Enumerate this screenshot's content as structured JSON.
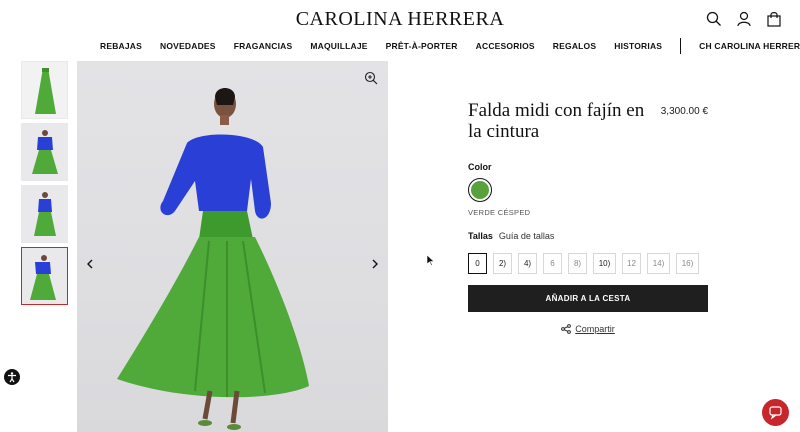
{
  "header": {
    "logo": "CAROLINA HERRERA",
    "icons": [
      "search-icon",
      "user-icon",
      "bag-icon"
    ]
  },
  "nav": {
    "items": [
      "REBAJAS",
      "NOVEDADES",
      "FRAGANCIAS",
      "MAQUILLAJE",
      "PRÊT-À-PORTER",
      "ACCESORIOS",
      "REGALOS",
      "HISTORIAS"
    ],
    "extra": "CH CAROLINA HERRERA"
  },
  "gallery": {
    "thumbnail_count": 4,
    "active_thumbnail": 4,
    "icons": [
      "zoom-icon",
      "arrow-left-icon",
      "arrow-right-icon"
    ]
  },
  "product": {
    "title": "Falda midi con fajín en la cintura",
    "price": "3,300.00 €",
    "color_label": "Color",
    "color_name": "VERDE CÉSPED",
    "swatch_color": "#5aa13d",
    "sizes_label": "Tallas",
    "size_guide": "Guía de tallas",
    "sizes": [
      "0",
      "2)",
      "4)",
      "6",
      "8)",
      "10)",
      "12",
      "14)",
      "16)"
    ],
    "selected_size": "0",
    "add_to_cart": "AÑADIR A LA CESTA",
    "share": "Compartir"
  },
  "colors": {
    "accent": "#c8262d",
    "button": "#1f1f1f",
    "skirt": "#4faa3a",
    "shirt": "#2a3fd6"
  }
}
